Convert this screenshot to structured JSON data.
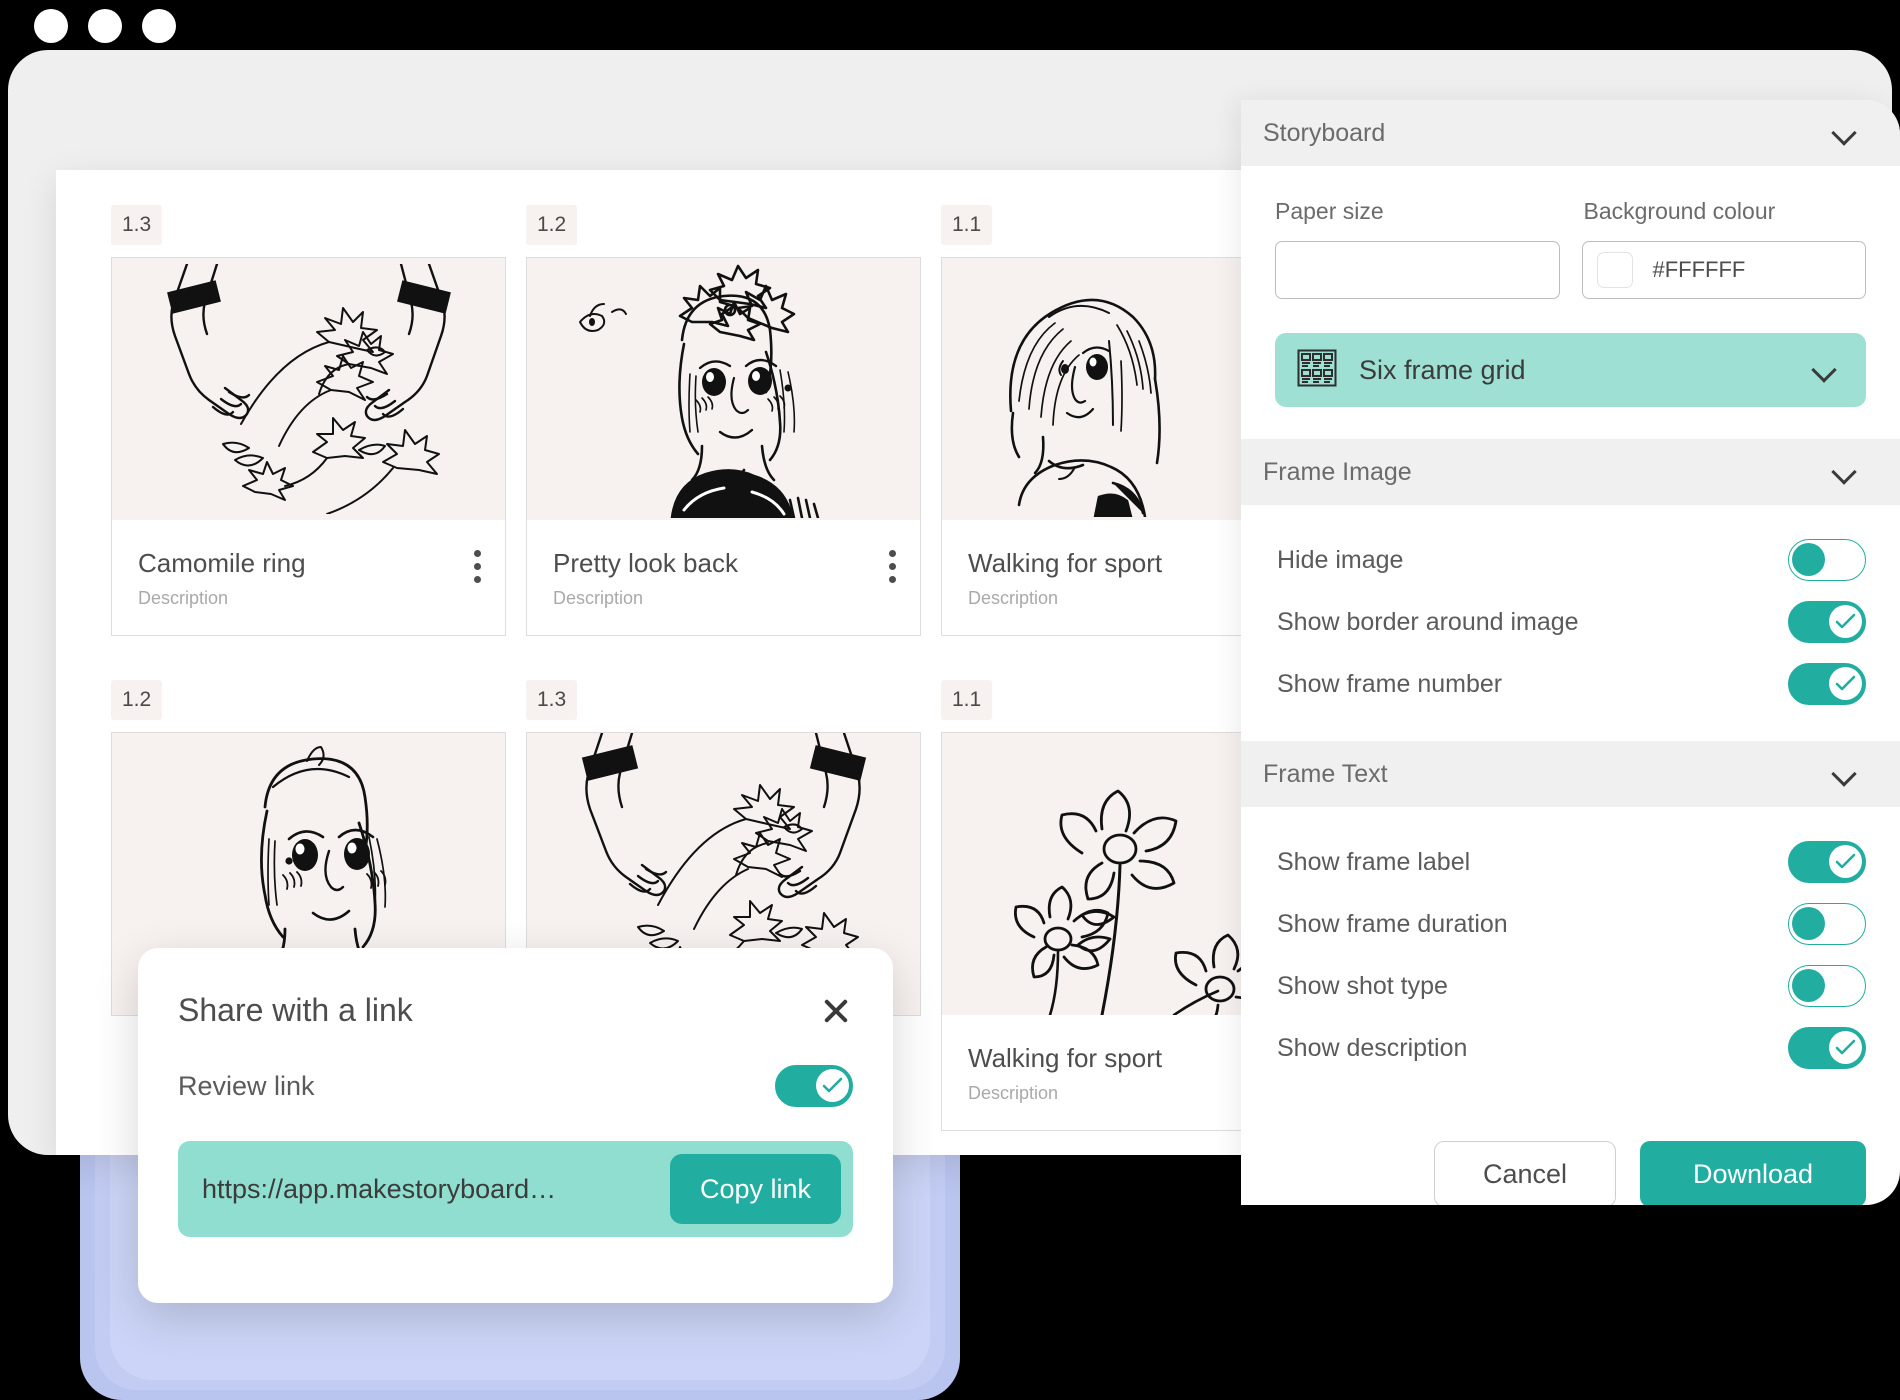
{
  "window": {
    "dots": [
      "dot-1",
      "dot-2",
      "dot-3"
    ]
  },
  "storyboard": {
    "frames": [
      {
        "number": "1.3",
        "title": "Camomile ring",
        "description": "Description",
        "art": "hands-flowers"
      },
      {
        "number": "1.2",
        "title": "Pretty look back",
        "description": "Description",
        "art": "girl-flower-crown"
      },
      {
        "number": "1.1",
        "title": "Walking for sport",
        "description": "Description",
        "art": "girl-portrait"
      },
      {
        "number": "1.2",
        "title": "",
        "description": "",
        "art": "girl-flower-crown"
      },
      {
        "number": "1.3",
        "title": "",
        "description": "",
        "art": "hands-flowers"
      },
      {
        "number": "1.1",
        "title": "Walking for sport",
        "description": "Description",
        "art": "daisies"
      }
    ]
  },
  "panel": {
    "storyboard_section": {
      "title": "Storyboard",
      "paper_size": {
        "label": "Paper size",
        "value": "",
        "placeholder": ""
      },
      "background_colour": {
        "label": "Background  colour",
        "value": "#FFFFFF",
        "swatch": "#FFFFFF"
      },
      "grid_select": {
        "label": "Six frame grid",
        "icon": "six-frame-grid-icon"
      }
    },
    "frame_image_section": {
      "title": "Frame Image",
      "toggles": [
        {
          "label": "Hide image",
          "state": "off"
        },
        {
          "label": "Show border around image",
          "state": "on"
        },
        {
          "label": "Show frame number",
          "state": "on"
        }
      ]
    },
    "frame_text_section": {
      "title": "Frame Text",
      "toggles": [
        {
          "label": "Show frame label",
          "state": "on"
        },
        {
          "label": "Show frame duration",
          "state": "off"
        },
        {
          "label": "Show shot type",
          "state": "off"
        },
        {
          "label": "Show description",
          "state": "on"
        }
      ]
    },
    "actions": {
      "cancel": "Cancel",
      "download": "Download"
    }
  },
  "share_dialog": {
    "title": "Share with a link",
    "close_icon": "close-icon",
    "review_link_label": "Review link",
    "review_link_state": "on",
    "url": "https://app.makestoryboard…",
    "copy_button": "Copy link"
  },
  "colors": {
    "accent": "#21ADA0",
    "accent_light": "#9FE0D4",
    "link_bar": "#8FDED0",
    "panel_header": "#F0F0F0",
    "frame_bg": "#F7F1EF",
    "stack_blue": "#B9C4EF"
  }
}
